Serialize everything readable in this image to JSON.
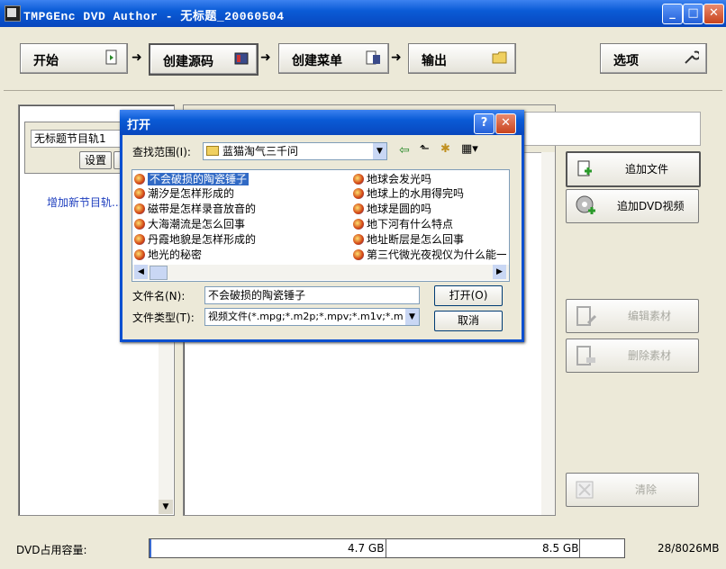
{
  "window": {
    "title": "TMPGEnc DVD Author - 无标题_20060504",
    "minimize": "_",
    "maximize": "□",
    "close": "✕"
  },
  "toolbar": {
    "start": "开始",
    "create_source": "创建源码",
    "create_menu": "创建菜单",
    "output": "输出",
    "options": "选项",
    "arrow": "➜"
  },
  "left_panel": {
    "track_name": "无标题节目轨1",
    "settings_button": "设置",
    "add_track": "增加新节目轨..."
  },
  "right_buttons": {
    "add_file": "追加文件",
    "add_dvd": "追加DVD视频",
    "edit": "编辑素材",
    "delete": "删除素材",
    "clear": "清除"
  },
  "status": {
    "label": "DVD占用容量:",
    "mark1": "4.7 GB",
    "mark2": "8.5 GB",
    "usage": "28/8026MB",
    "usage_fraction": 0.0035
  },
  "dialog": {
    "title": "打开",
    "look_in_label": "查找范围(I):",
    "look_in_value": "蓝猫淘气三千问",
    "files_left": [
      "不会破损的陶瓷锤子",
      "潮汐是怎样形成的",
      "磁带是怎样录音放音的",
      "大海潮流是怎么回事",
      "丹霞地貌是怎样形成的",
      "地光的秘密"
    ],
    "files_right": [
      "地球会发光吗",
      "地球上的水用得完吗",
      "地球是圆的吗",
      "地下河有什么特点",
      "地址断层是怎么回事",
      "第三代微光夜视仪为什么能一"
    ],
    "filename_label": "文件名(N):",
    "filename_value": "不会破损的陶瓷锤子",
    "filetype_label": "文件类型(T):",
    "filetype_value": "视频文件(*.mpg;*.m2p;*.mpv;*.m1v;*.m",
    "open_button": "打开(O)",
    "cancel_button": "取消",
    "help": "?",
    "close": "✕"
  }
}
